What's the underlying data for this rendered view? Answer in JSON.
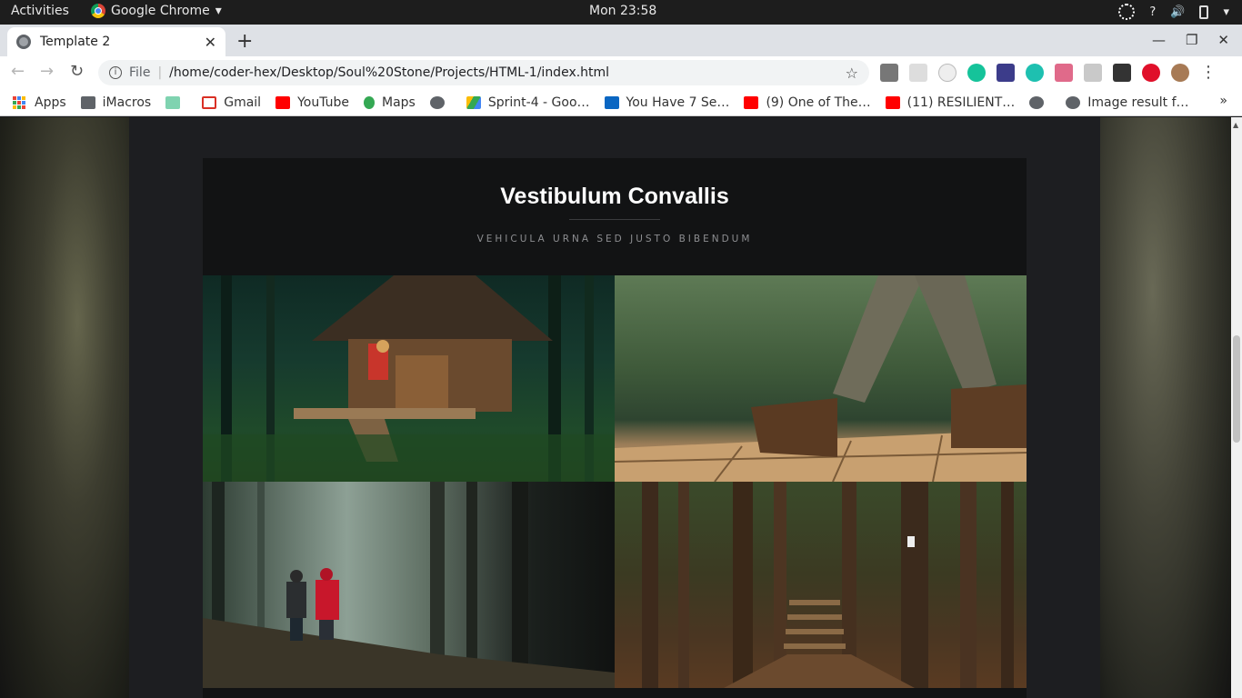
{
  "system_bar": {
    "activities": "Activities",
    "app_name": "Google Chrome",
    "clock": "Mon 23:58",
    "help": "?"
  },
  "browser": {
    "tab_title": "Template 2",
    "url_scheme": "File",
    "url": "/home/coder-hex/Desktop/Soul%20Stone/Projects/HTML-1/index.html"
  },
  "bookmarks": [
    {
      "label": "Apps",
      "icon": "apps-grid-icon"
    },
    {
      "label": "iMacros",
      "icon": "folder-icon"
    },
    {
      "label": "",
      "icon": "android-icon"
    },
    {
      "label": "Gmail",
      "icon": "gmail-icon"
    },
    {
      "label": "YouTube",
      "icon": "youtube-icon"
    },
    {
      "label": "Maps",
      "icon": "maps-icon"
    },
    {
      "label": "",
      "icon": "globe-icon"
    },
    {
      "label": "Sprint-4 - Goo…",
      "icon": "drive-icon"
    },
    {
      "label": "You Have 7 Se…",
      "icon": "linkedin-icon"
    },
    {
      "label": "(9) One of The…",
      "icon": "youtube-icon"
    },
    {
      "label": "(11) RESILIENT…",
      "icon": "youtube-icon"
    },
    {
      "label": "",
      "icon": "globe-icon"
    },
    {
      "label": "Image result f…",
      "icon": "globe-icon"
    }
  ],
  "bookmarks_more": "»",
  "page": {
    "title": "Vestibulum Convallis",
    "subtitle": "VEHICULA URNA SED JUSTO BIBENDUM",
    "gallery": [
      {
        "name": "forest-cabin-photo"
      },
      {
        "name": "hiker-boots-boardwalk-photo"
      },
      {
        "name": "couple-walking-misty-forest-photo"
      },
      {
        "name": "forest-steps-trail-photo"
      }
    ]
  },
  "colors": {
    "page_bg": "#1d1e21",
    "card_bg": "#121314",
    "title": "#ffffff",
    "subtitle": "#8d8e91"
  }
}
